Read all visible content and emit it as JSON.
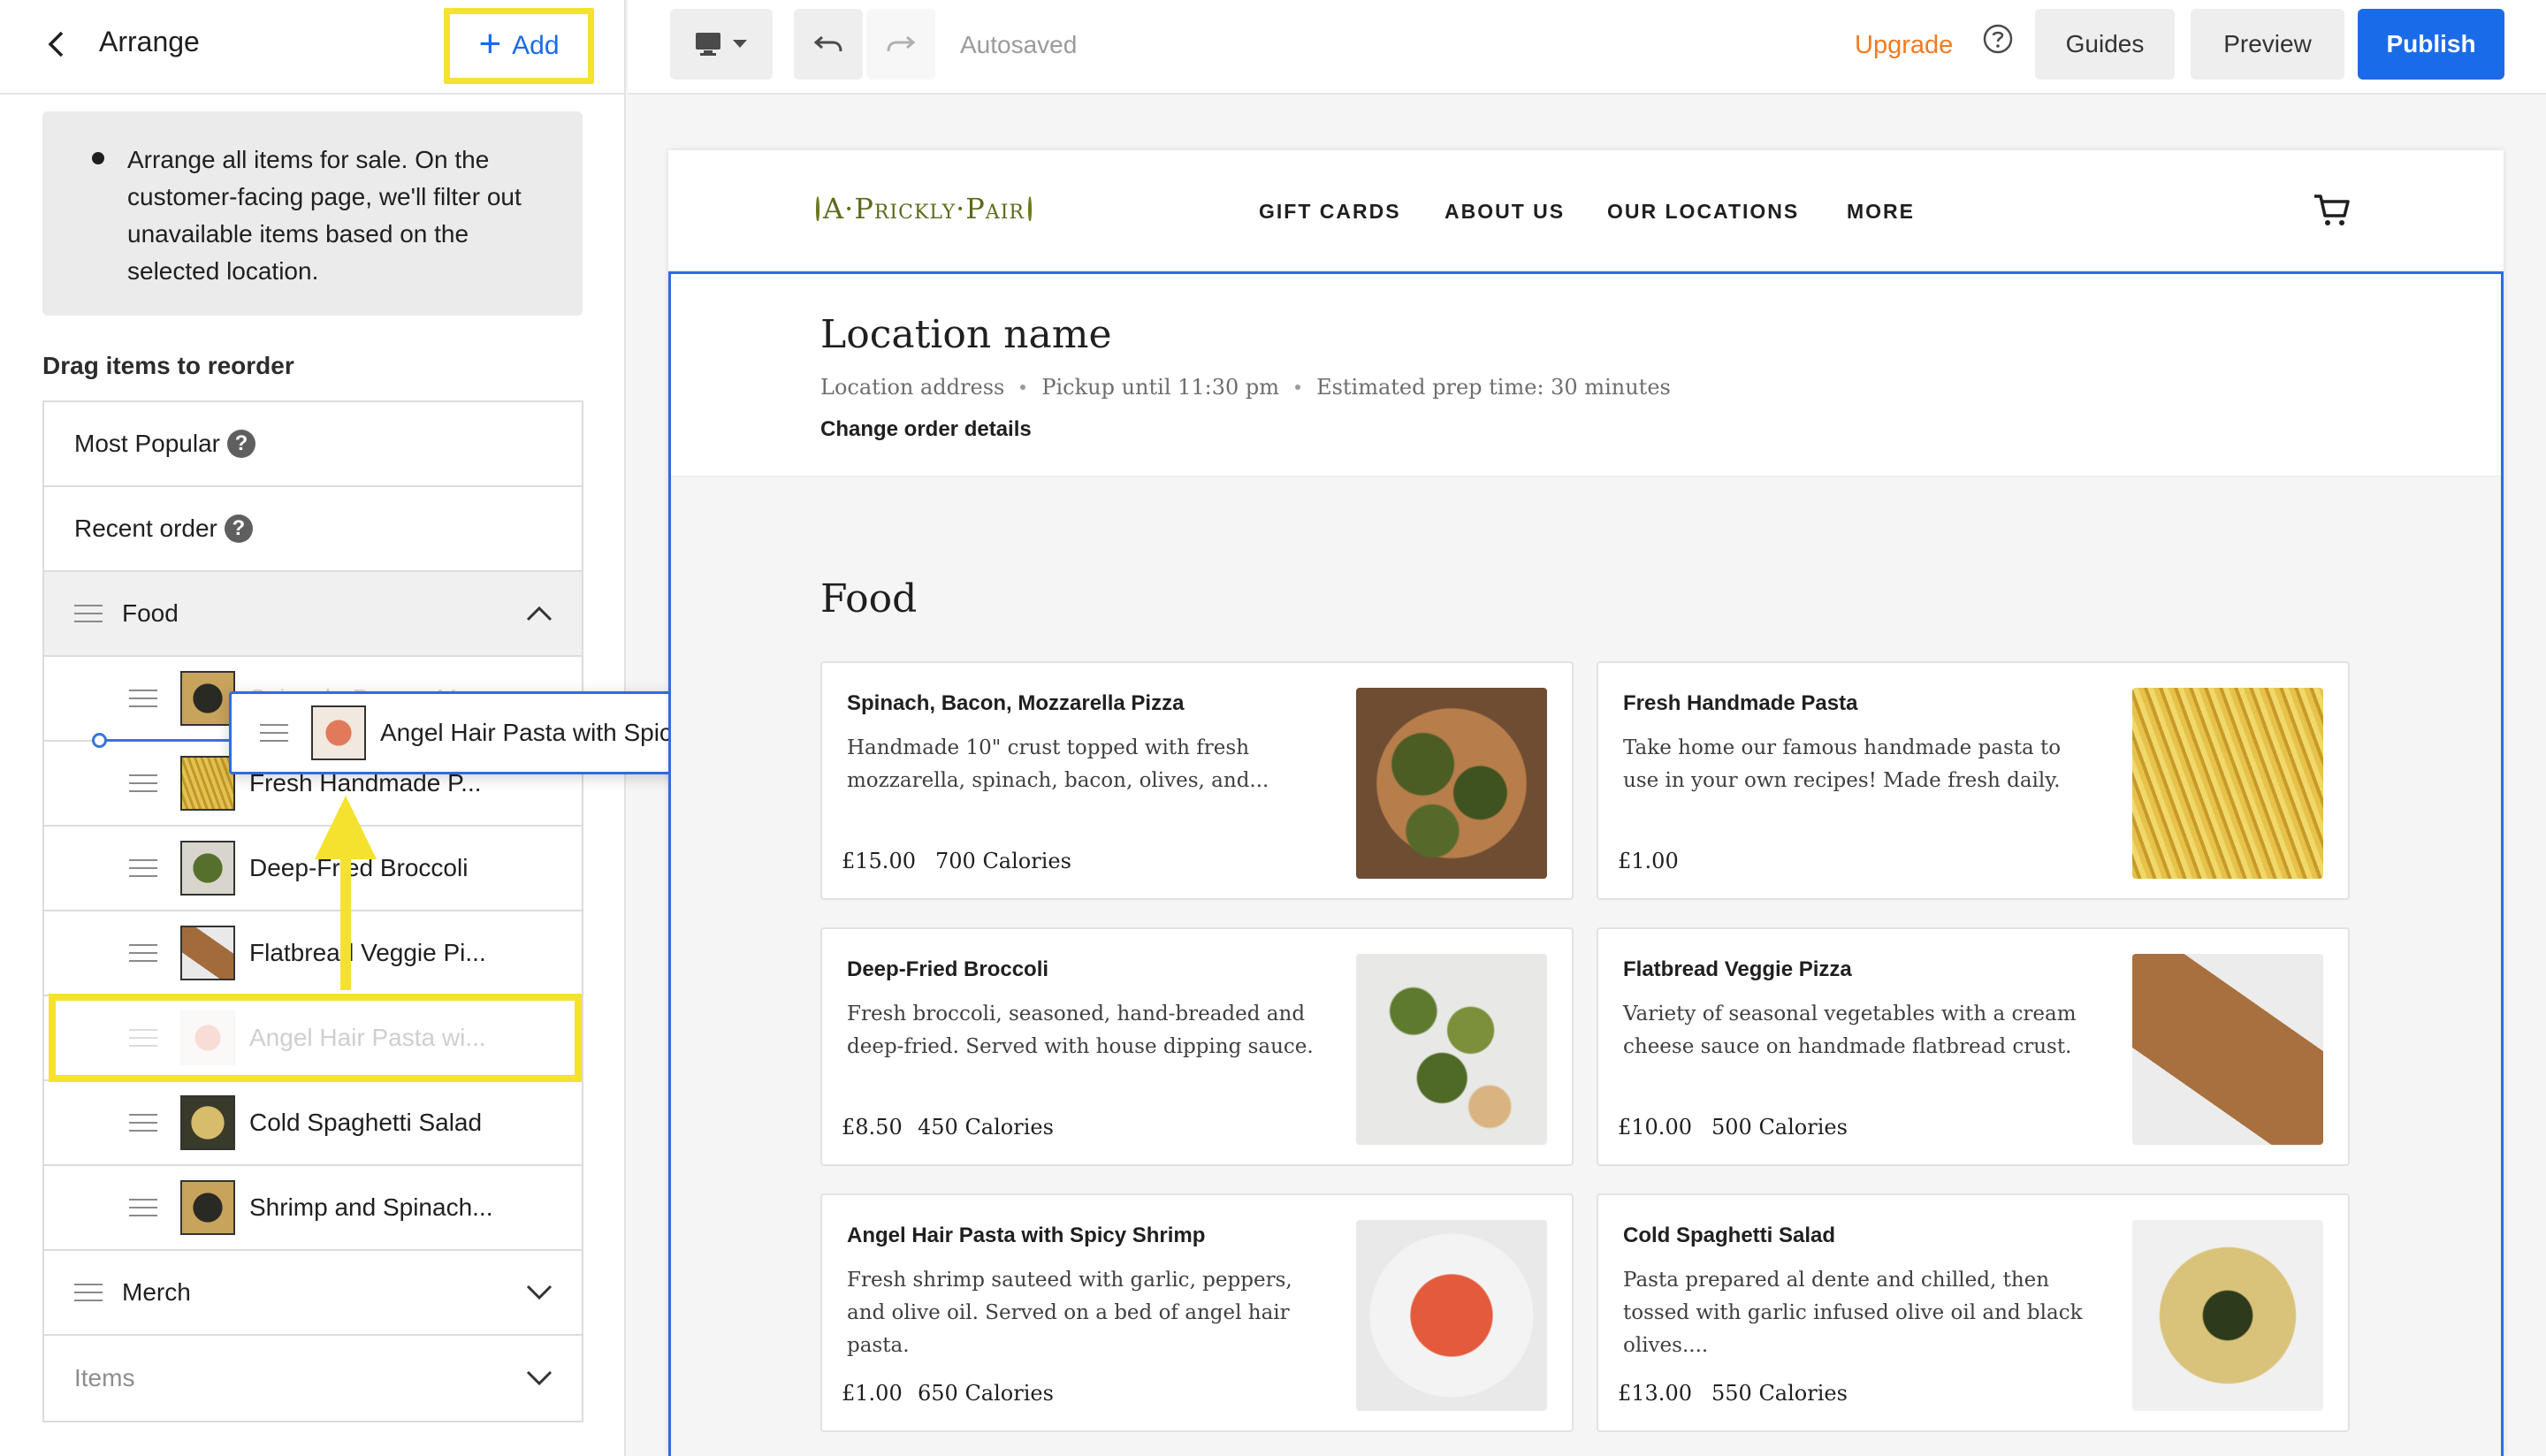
{
  "sidebar": {
    "title": "Arrange",
    "add_label": "Add",
    "info_text": "Arrange all items for sale. On the customer-facing page, we'll filter out unavailable items based on the selected location.",
    "drag_label": "Drag items to reorder",
    "top_items": [
      {
        "label": "Most Popular"
      },
      {
        "label": "Recent order"
      }
    ],
    "food_category": "Food",
    "food_items": [
      {
        "label": "Spinach, Bacon, Mo...",
        "thumb": "spinach-pizza-thumb"
      },
      {
        "label": "Fresh Handmade P...",
        "thumb": "pasta-thumb"
      },
      {
        "label": "Deep-Fried Broccoli",
        "thumb": "broccoli-thumb"
      },
      {
        "label": "Flatbread Veggie Pi...",
        "thumb": "flatbread-thumb"
      },
      {
        "label": "Angel Hair Pasta wi...",
        "thumb": "shrimp-pasta-thumb"
      },
      {
        "label": "Cold Spaghetti Salad",
        "thumb": "salad-thumb"
      },
      {
        "label": "Shrimp and Spinach...",
        "thumb": "shrimp-spinach-thumb"
      }
    ],
    "merch_category": "Merch",
    "items_category": "Items",
    "dragging_label": "Angel Hair Pasta with Spicy ..."
  },
  "toolbar": {
    "autosaved": "Autosaved",
    "upgrade": "Upgrade",
    "guides": "Guides",
    "preview": "Preview",
    "publish": "Publish"
  },
  "site": {
    "logo": "A·Prickly·Pair",
    "nav": [
      "GIFT CARDS",
      "ABOUT US",
      "OUR LOCATIONS",
      "MORE"
    ],
    "location_name": "Location name",
    "location_address": "Location address",
    "pickup": "Pickup until 11:30 pm",
    "prep_time": "Estimated prep time: 30 minutes",
    "change_order": "Change order details",
    "section_title": "Food",
    "cards": [
      {
        "name": "Spinach, Bacon, Mozzarella Pizza",
        "desc": "Handmade 10\" crust topped with fresh mozzarella, spinach, bacon, olives, and...",
        "price": "£15.00",
        "calories": "700 Calories"
      },
      {
        "name": "Fresh Handmade Pasta",
        "desc": "Take home our famous handmade pasta to use in your own recipes! Made fresh daily.",
        "price": "£1.00",
        "calories": ""
      },
      {
        "name": "Deep-Fried Broccoli",
        "desc": "Fresh broccoli, seasoned, hand-breaded and deep-fried. Served with house dipping sauce.",
        "price": "£8.50",
        "calories": "450 Calories"
      },
      {
        "name": "Flatbread Veggie Pizza",
        "desc": "Variety of seasonal vegetables with a cream cheese sauce on handmade flatbread crust.",
        "price": "£10.00",
        "calories": "500 Calories"
      },
      {
        "name": "Angel Hair Pasta with Spicy Shrimp",
        "desc": "Fresh shrimp sauteed with garlic, peppers, and olive oil. Served on a bed of angel hair pasta.",
        "price": "£1.00",
        "calories": "650 Calories"
      },
      {
        "name": "Cold Spaghetti Salad",
        "desc": "Pasta prepared al dente and chilled, then tossed with garlic infused olive oil and black olives....",
        "price": "£13.00",
        "calories": "550 Calories"
      }
    ]
  },
  "colors": {
    "accent_blue": "#1a6be8",
    "highlight_yellow": "#f5e22f",
    "upgrade_orange": "#f17a22"
  }
}
